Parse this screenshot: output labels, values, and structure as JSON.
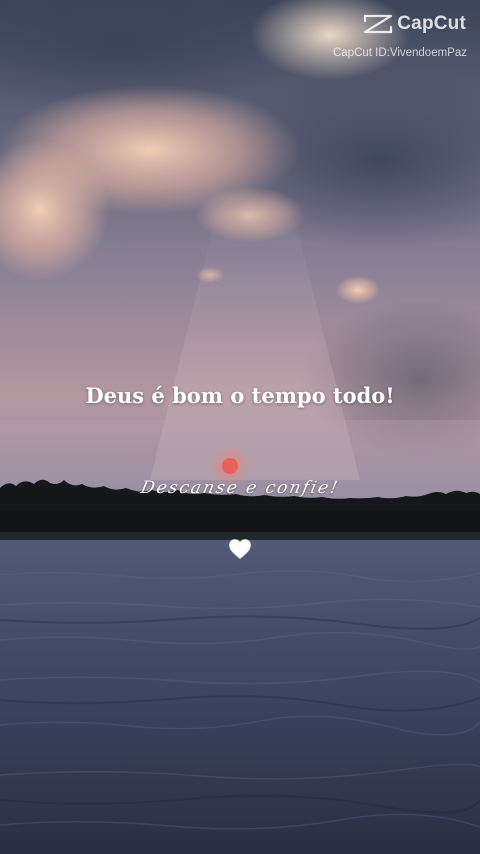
{
  "watermark": {
    "brand": "CapCut",
    "id_line": "CapCut ID:VivendoemPaz"
  },
  "overlay": {
    "headline": "Deus é bom o tempo todo!",
    "caption": "Descanse e confie!",
    "emoji": "white-heart-icon"
  },
  "scene": {
    "sky_colors": [
      "#3b4357",
      "#6f6f88",
      "#c8a8a6"
    ],
    "cloud_highlight": "#f4cdb2",
    "sun_color": "#e8605c",
    "treeline_color": "#14181a",
    "water_colors": [
      "#4c5270",
      "#2b3042"
    ]
  }
}
